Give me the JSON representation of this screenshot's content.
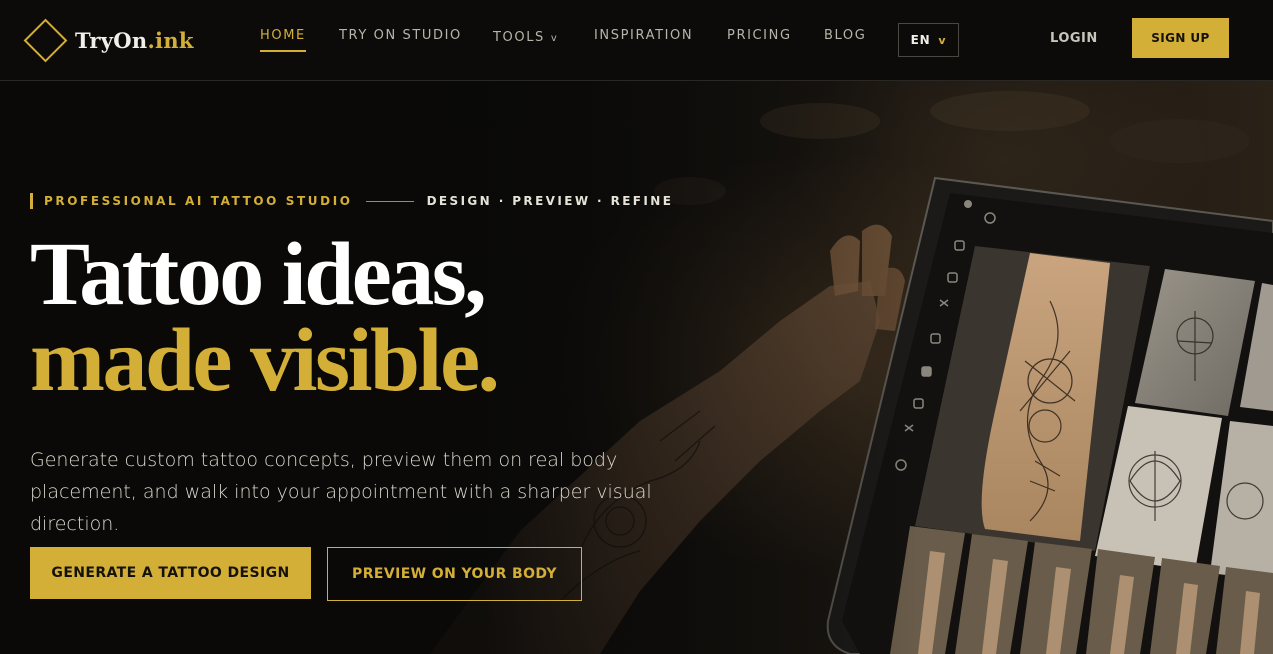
{
  "brand": {
    "name_main": "TryOn",
    "name_accent": ".ink",
    "accent_color": "#d4af37"
  },
  "nav": {
    "items": [
      {
        "label": "HOME",
        "active": true
      },
      {
        "label": "TRY ON STUDIO",
        "active": false
      },
      {
        "label": "TOOLS",
        "active": false,
        "caret": "v"
      },
      {
        "label": "INSPIRATION",
        "active": false
      },
      {
        "label": "PRICING",
        "active": false
      },
      {
        "label": "BLOG",
        "active": false
      }
    ],
    "language": {
      "label": "EN",
      "caret": "v"
    },
    "login_label": "LOGIN",
    "signup_label": "SIGN UP"
  },
  "hero": {
    "eyebrow": "PROFESSIONAL AI TATTOO STUDIO",
    "eyebrow_sub": "DESIGN · PREVIEW · REFINE",
    "headline_line1": "Tattoo ideas,",
    "headline_line2": "made visible.",
    "subcopy": "Generate custom tattoo concepts, preview them on real body placement, and walk into your appointment with a sharper visual direction.",
    "cta_primary": "GENERATE A TATTOO DESIGN",
    "cta_secondary": "PREVIEW ON YOUR BODY"
  },
  "colors": {
    "background": "#0a0908",
    "accent": "#d4af37",
    "text_light": "#ffffff"
  }
}
